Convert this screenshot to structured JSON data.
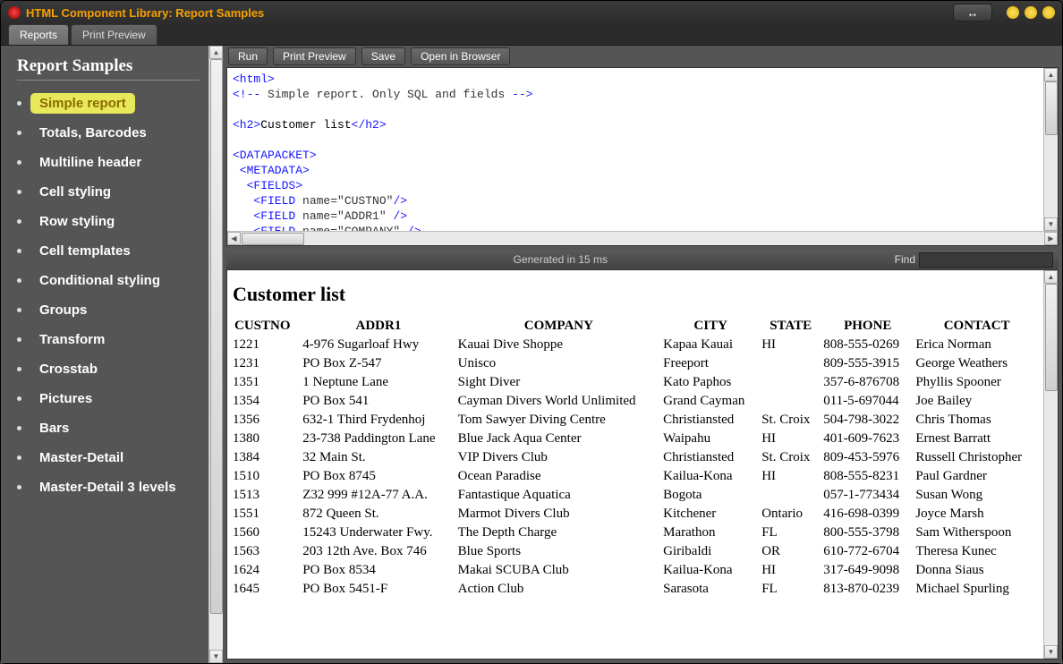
{
  "window": {
    "title": "HTML Component Library: Report Samples"
  },
  "tabs": [
    {
      "label": "Reports",
      "active": true
    },
    {
      "label": "Print Preview",
      "active": false
    }
  ],
  "sidebar": {
    "heading": "Report Samples",
    "items": [
      {
        "label": "Simple report",
        "selected": true
      },
      {
        "label": "Totals, Barcodes"
      },
      {
        "label": "Multiline header"
      },
      {
        "label": "Cell styling"
      },
      {
        "label": "Row styling"
      },
      {
        "label": "Cell templates"
      },
      {
        "label": "Conditional styling"
      },
      {
        "label": "Groups"
      },
      {
        "label": "Transform"
      },
      {
        "label": "Crosstab"
      },
      {
        "label": "Pictures"
      },
      {
        "label": "Bars"
      },
      {
        "label": "Master-Detail"
      },
      {
        "label": "Master-Detail 3 levels"
      }
    ]
  },
  "toolbar": {
    "run": "Run",
    "print_preview": "Print Preview",
    "save": "Save",
    "open_browser": "Open in Browser"
  },
  "code": {
    "lines": [
      {
        "type": "tag",
        "text": "<html>"
      },
      {
        "type": "comment",
        "text": "<!-- Simple report. Only SQL and fields -->"
      },
      {
        "type": "blank",
        "text": ""
      },
      {
        "type": "mixed",
        "lead": "<h2>",
        "mid": "Customer list",
        "tail": "</h2>"
      },
      {
        "type": "blank",
        "text": ""
      },
      {
        "type": "tag",
        "text": "<DATAPACKET>"
      },
      {
        "type": "tag",
        "text": " <METADATA>"
      },
      {
        "type": "tag",
        "text": "  <FIELDS>"
      },
      {
        "type": "tagattr",
        "lead": "   <FIELD ",
        "attr": "name=\"CUSTNO\"",
        "tail": "/>"
      },
      {
        "type": "tagattr",
        "lead": "   <FIELD ",
        "attr": "name=\"ADDR1\" ",
        "tail": "/>"
      },
      {
        "type": "tagattr",
        "lead": "   <FIELD ",
        "attr": "name=\"COMPANY\" ",
        "tail": "/>"
      }
    ]
  },
  "status": {
    "generated": "Generated in 15 ms",
    "find_label": "Find"
  },
  "report": {
    "title": "Customer list",
    "columns": [
      "CUSTNO",
      "ADDR1",
      "COMPANY",
      "CITY",
      "STATE",
      "PHONE",
      "CONTACT"
    ],
    "rows": [
      [
        "1221",
        "4-976 Sugarloaf Hwy",
        "Kauai Dive Shoppe",
        "Kapaa Kauai",
        "HI",
        "808-555-0269",
        "Erica Norman"
      ],
      [
        "1231",
        "PO Box Z-547",
        "Unisco",
        "Freeport",
        "",
        "809-555-3915",
        "George Weathers"
      ],
      [
        "1351",
        "1 Neptune Lane",
        "Sight Diver",
        "Kato Paphos",
        "",
        "357-6-876708",
        "Phyllis Spooner"
      ],
      [
        "1354",
        "PO Box 541",
        "Cayman Divers World Unlimited",
        "Grand Cayman",
        "",
        "011-5-697044",
        "Joe Bailey"
      ],
      [
        "1356",
        "632-1 Third Frydenhoj",
        "Tom Sawyer Diving Centre",
        "Christiansted",
        "St. Croix",
        "504-798-3022",
        "Chris Thomas"
      ],
      [
        "1380",
        "23-738 Paddington Lane",
        "Blue Jack Aqua Center",
        "Waipahu",
        "HI",
        "401-609-7623",
        "Ernest Barratt"
      ],
      [
        "1384",
        "32 Main St.",
        "VIP Divers Club",
        "Christiansted",
        "St. Croix",
        "809-453-5976",
        "Russell Christopher"
      ],
      [
        "1510",
        "PO Box 8745",
        "Ocean Paradise",
        "Kailua-Kona",
        "HI",
        "808-555-8231",
        "Paul Gardner"
      ],
      [
        "1513",
        "Z32 999 #12A-77 A.A.",
        "Fantastique Aquatica",
        "Bogota",
        "",
        "057-1-773434",
        "Susan Wong"
      ],
      [
        "1551",
        "872 Queen St.",
        "Marmot Divers Club",
        "Kitchener",
        "Ontario",
        "416-698-0399",
        "Joyce Marsh"
      ],
      [
        "1560",
        "15243 Underwater Fwy.",
        "The Depth Charge",
        "Marathon",
        "FL",
        "800-555-3798",
        "Sam Witherspoon"
      ],
      [
        "1563",
        "203 12th Ave. Box 746",
        "Blue Sports",
        "Giribaldi",
        "OR",
        "610-772-6704",
        "Theresa Kunec"
      ],
      [
        "1624",
        "PO Box 8534",
        "Makai SCUBA Club",
        "Kailua-Kona",
        "HI",
        "317-649-9098",
        "Donna Siaus"
      ],
      [
        "1645",
        "PO Box 5451-F",
        "Action Club",
        "Sarasota",
        "FL",
        "813-870-0239",
        "Michael Spurling"
      ]
    ]
  }
}
